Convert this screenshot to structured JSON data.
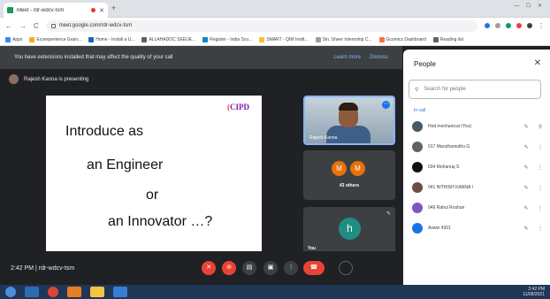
{
  "browser": {
    "tab_title": "Meet - rdr-wdcv-tsm",
    "url": "meet.google.com/rdr-wdcv-tsm",
    "bookmarks": [
      "Apps",
      "Ecoexperience Grain...",
      "Home - Install a U...",
      "ALLAHADOC SEEUE...",
      "Register - India Sco...",
      "SMART - QIM Instit...",
      "Sin. Sheer Internship C...",
      "Gcomics Dashboard",
      "Reading list"
    ],
    "window_controls": "— ☐ ✕"
  },
  "meet": {
    "banner_text": "You have extensions installed that may affect the quality of your call",
    "banner_learn_more": "Learn more",
    "banner_dismiss": "Dismiss",
    "presenting": "Rajesh Kanna is presenting",
    "slide": {
      "logo": "CIPD",
      "lines": [
        "Introduce as",
        "an Engineer",
        "or",
        "an Innovator …?"
      ]
    },
    "tiles": {
      "presenter_name": "Rajesh Kanna",
      "others_badges": [
        "M",
        "M"
      ],
      "others_label": "43 others",
      "self_initial": "h",
      "self_label": "You"
    },
    "controls": {
      "time_meeting": "2:42 PM  |  rdr-wdcv-tsm"
    }
  },
  "people": {
    "title": "People",
    "search_placeholder": "Search for people",
    "in_call": "In call",
    "members": [
      {
        "name": "Hod mechanical (You)",
        "color": "#455a64"
      },
      {
        "name": "017 Maruthamuthu G",
        "color": "#5f6368"
      },
      {
        "name": "034 Mohanraj S",
        "color": "#111111"
      },
      {
        "name": "041 NITHISH KANNA I",
        "color": "#6d4c41"
      },
      {
        "name": "049 Rahul Roshan",
        "color": "#7e57c2"
      },
      {
        "name": "Aswin 4301",
        "color": "#1a73e8"
      }
    ]
  },
  "taskbar": {
    "clock_time": "2:42 PM",
    "clock_date": "11/08/2021"
  },
  "colors": {
    "accent": "#1a73e8",
    "danger": "#ea4335",
    "meet_bg": "#202124"
  }
}
